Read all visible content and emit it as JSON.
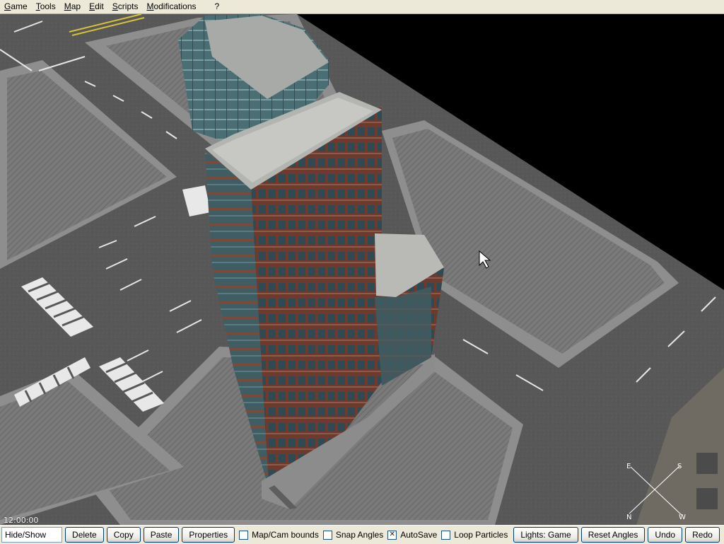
{
  "menu": {
    "items": [
      {
        "label": "Game"
      },
      {
        "label": "Tools"
      },
      {
        "label": "Map"
      },
      {
        "label": "Edit"
      },
      {
        "label": "Scripts"
      },
      {
        "label": "Modifications"
      },
      {
        "label": "?"
      }
    ]
  },
  "viewport": {
    "clock": "12:00:00",
    "compass": {
      "n": "N",
      "e": "E",
      "s": "S",
      "w": "W"
    }
  },
  "toolbar": {
    "hide_show": "Hide/Show",
    "delete": "Delete",
    "copy": "Copy",
    "paste": "Paste",
    "properties": "Properties",
    "map_cam_bounds": {
      "label": "Map/Cam bounds",
      "checked": false
    },
    "snap_angles": {
      "label": "Snap Angles",
      "checked": false
    },
    "autosave": {
      "label": "AutoSave",
      "checked": true
    },
    "loop_particles": {
      "label": "Loop Particles",
      "checked": false
    },
    "lights": "Lights: Game",
    "reset_angles": "Reset Angles",
    "undo": "Undo",
    "redo": "Redo"
  },
  "colors": {
    "menubar": "#ece9d8",
    "asphalt": "#5a5a5a",
    "sidewalk": "#9a9a9a",
    "tower_brick": "#6e3a2e",
    "tower_glass": "#3f5d63"
  }
}
